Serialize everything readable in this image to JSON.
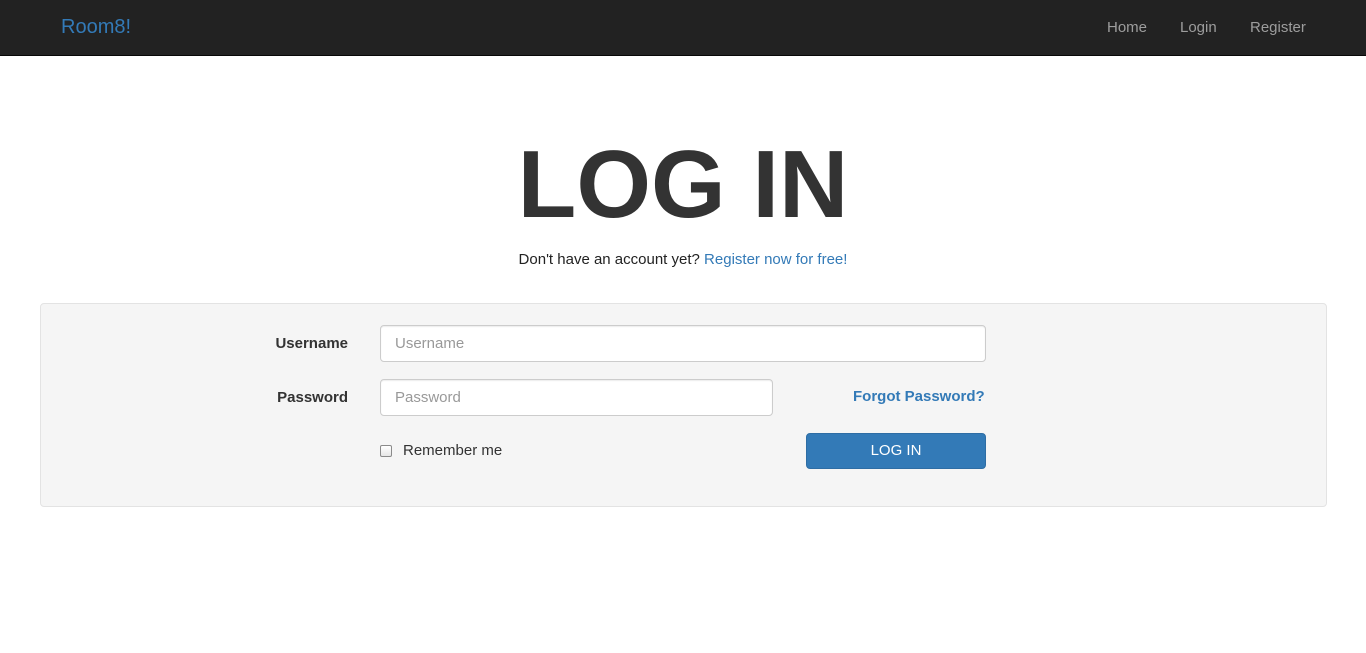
{
  "navbar": {
    "brand": "Room8!",
    "links": [
      "Home",
      "Login",
      "Register"
    ]
  },
  "page": {
    "title": "LOG IN",
    "subtitle_text": "Don't have an account yet?",
    "register_link": "Register now for free!"
  },
  "form": {
    "username_label": "Username",
    "username_placeholder": "Username",
    "username_value": "",
    "password_label": "Password",
    "password_placeholder": "Password",
    "password_value": "",
    "forgot_link": "Forgot Password?",
    "remember_label": "Remember me",
    "remember_checked": false,
    "submit_label": "LOG IN"
  },
  "colors": {
    "navbar_bg": "#222222",
    "brand": "#337ab7",
    "nav_link": "#9d9d9d",
    "primary": "#337ab7",
    "well_bg": "#f5f5f5"
  }
}
